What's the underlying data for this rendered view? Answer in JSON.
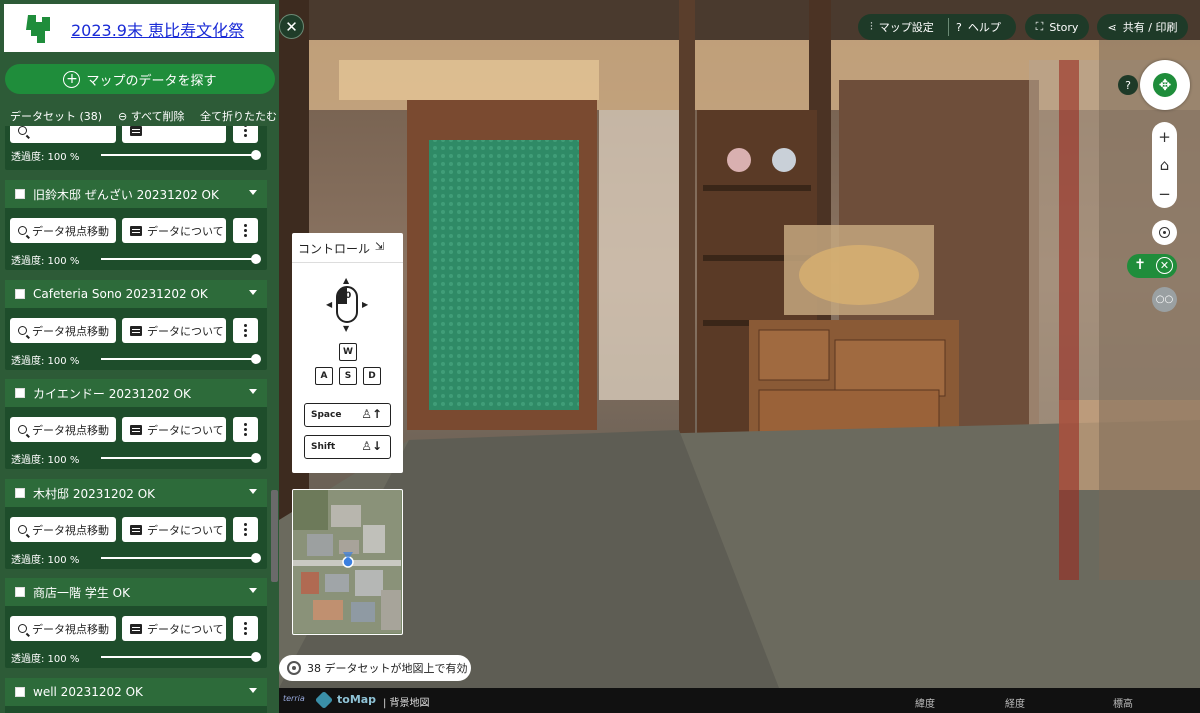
{
  "app": {
    "title": "2023.9末 恵比寿文化祭",
    "accent": "#1f8d3b",
    "sidebar_bg": "#2d5b37"
  },
  "sidebar": {
    "search_button": "マップのデータを探す",
    "dataset_count": "データセット (38)",
    "clear_all": "すべて削除",
    "collapse_all": "全て折りたたむ",
    "partial_opacity": "透過度: 100 %",
    "items": [
      {
        "name": "旧鈴木邸 ぜんざい 20231202 OK",
        "view": "データ視点移動",
        "about": "データについて",
        "opacity": "透過度: 100 %"
      },
      {
        "name": "Cafeteria Sono 20231202 OK",
        "view": "データ視点移動",
        "about": "データについて",
        "opacity": "透過度: 100 %"
      },
      {
        "name": "カイエンドー 20231202 OK",
        "view": "データ視点移動",
        "about": "データについて",
        "opacity": "透過度: 100 %"
      },
      {
        "name": "木村邸 20231202 OK",
        "view": "データ視点移動",
        "about": "データについて",
        "opacity": "透過度: 100 %"
      },
      {
        "name": "商店一階 学生 OK",
        "view": "データ視点移動",
        "about": "データについて",
        "opacity": "透過度: 100 %"
      },
      {
        "name": "well 20231202 OK"
      }
    ]
  },
  "toolbar": {
    "map_settings": "マップ設定",
    "help": "ヘルプ",
    "story": "Story",
    "share": "共有 / 印刷"
  },
  "controls": {
    "title": "コントロール",
    "mouse_button": "0",
    "keys": [
      "W",
      "A",
      "S",
      "D"
    ],
    "space": "Space",
    "shift": "Shift"
  },
  "map_controls": {
    "help": "?",
    "zoom_in": "+",
    "zoom_out": "−"
  },
  "badge": "38 データセットが地図上で有効",
  "footer": {
    "terria": "terria",
    "tomap": "toMap",
    "background_map": "| 背景地図",
    "lat": "緯度",
    "lon": "経度",
    "elev": "標高"
  }
}
